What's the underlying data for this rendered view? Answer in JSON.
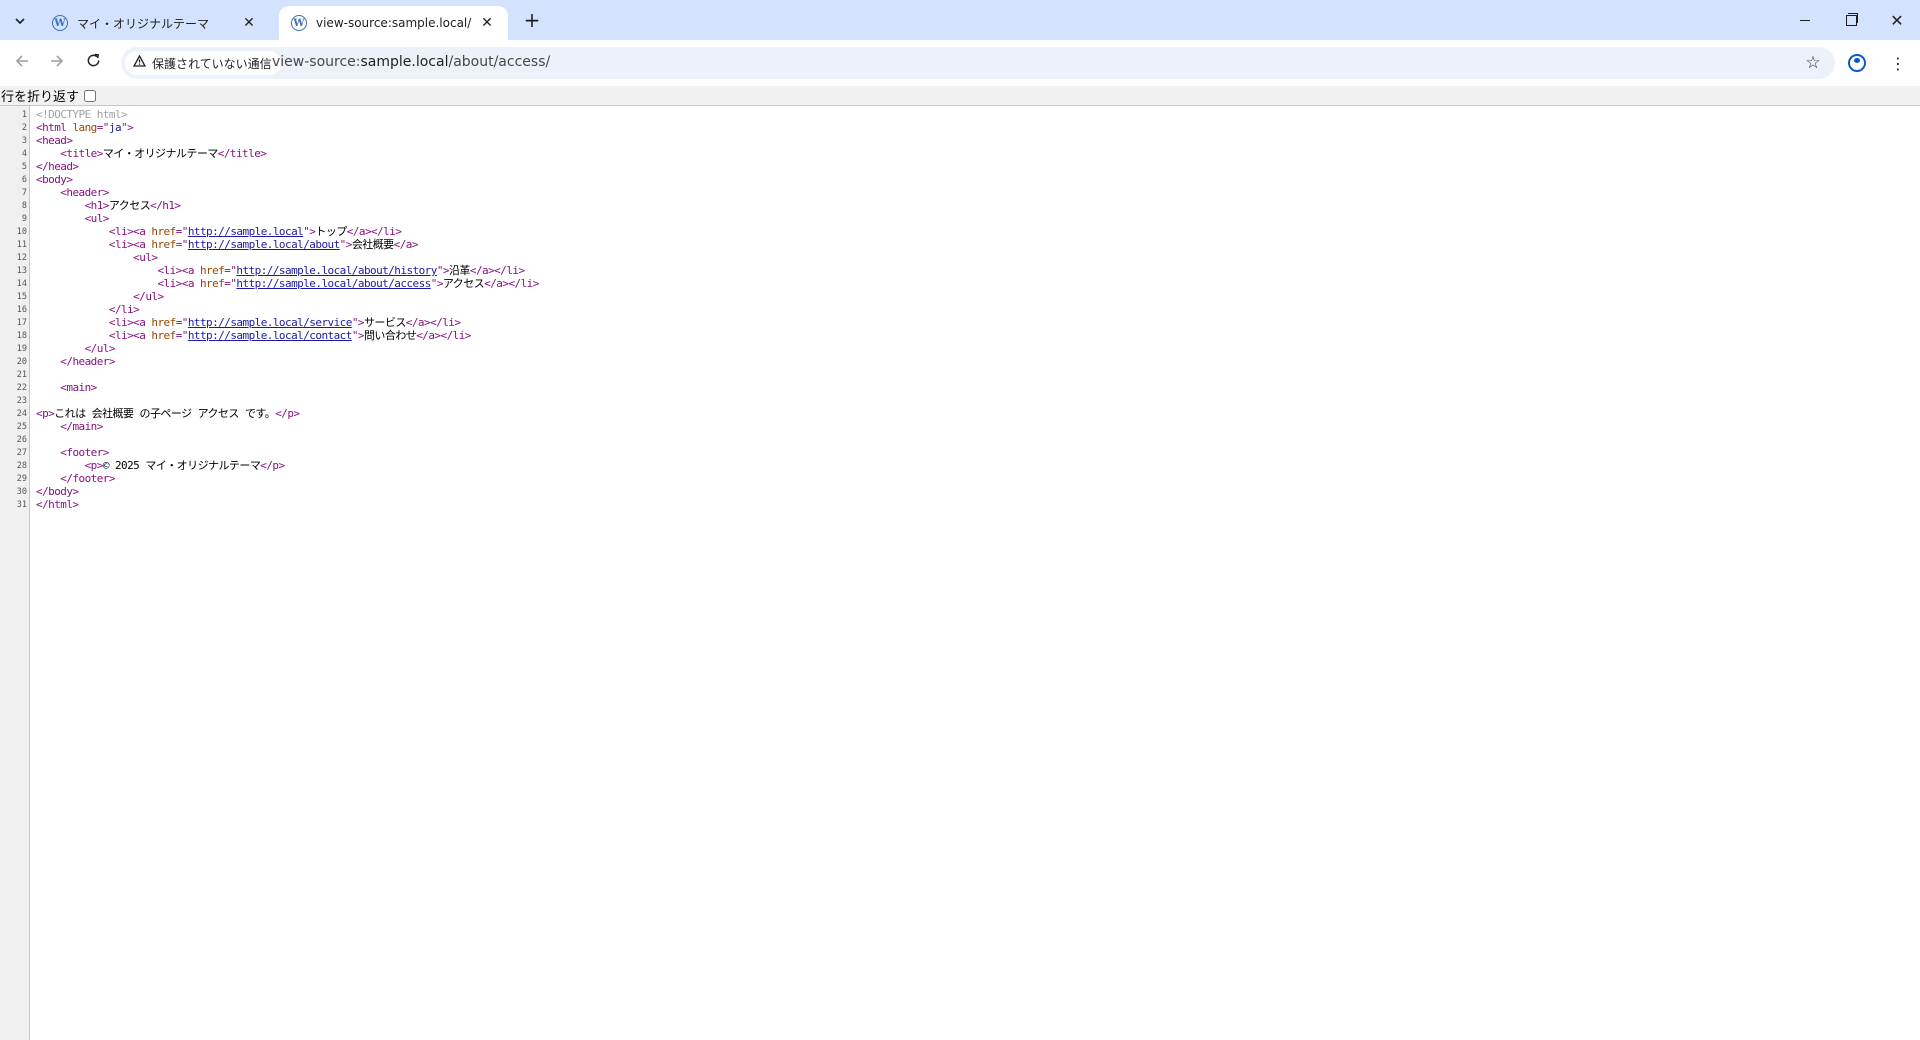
{
  "tabs": [
    {
      "title": "マイ・オリジナルテーマ",
      "active": false
    },
    {
      "title": "view-source:sample.local/about",
      "active": true
    }
  ],
  "toolbar": {
    "security_label": "保護されていない通信",
    "url_scheme": "view-source:",
    "url_host": "sample.local",
    "url_path": "/about/access/"
  },
  "page": {
    "wrap_label": "行を折り返す",
    "wrap_checked": false
  },
  "icons": {
    "tab_search": "chevron-down-icon",
    "favicon": "wordpress-icon",
    "close": "close-icon",
    "new_tab": "plus-icon",
    "back": "arrow-left-icon",
    "forward": "arrow-right-icon",
    "reload": "reload-icon",
    "warning": "warning-triangle-icon",
    "bookmark": "star-icon",
    "profile": "profile-icon",
    "menu": "kebab-menu-icon"
  },
  "source_lines": [
    {
      "n": "1",
      "indent": "",
      "parts": [
        [
          "doctype",
          "<!DOCTYPE html>"
        ]
      ]
    },
    {
      "n": "2",
      "indent": "",
      "parts": [
        [
          "tag",
          "<html "
        ],
        [
          "attr",
          "lang"
        ],
        [
          "tag",
          "=\""
        ],
        [
          "val",
          "ja"
        ],
        [
          "tag",
          "\">"
        ]
      ]
    },
    {
      "n": "3",
      "indent": "",
      "parts": [
        [
          "tag",
          "<head>"
        ]
      ]
    },
    {
      "n": "4",
      "indent": "    ",
      "parts": [
        [
          "tag",
          "<title>"
        ],
        [
          "text",
          "マイ・オリジナルテーマ"
        ],
        [
          "tag",
          "</title>"
        ]
      ]
    },
    {
      "n": "5",
      "indent": "",
      "parts": [
        [
          "tag",
          "</head>"
        ]
      ]
    },
    {
      "n": "6",
      "indent": "",
      "parts": [
        [
          "tag",
          "<body>"
        ]
      ]
    },
    {
      "n": "7",
      "indent": "    ",
      "parts": [
        [
          "tag",
          "<header>"
        ]
      ]
    },
    {
      "n": "8",
      "indent": "        ",
      "parts": [
        [
          "tag",
          "<h1>"
        ],
        [
          "text",
          "アクセス"
        ],
        [
          "tag",
          "</h1>"
        ]
      ]
    },
    {
      "n": "9",
      "indent": "        ",
      "parts": [
        [
          "tag",
          "<ul>"
        ]
      ]
    },
    {
      "n": "10",
      "indent": "            ",
      "parts": [
        [
          "tag",
          "<li><a "
        ],
        [
          "attr",
          "href"
        ],
        [
          "tag",
          "=\""
        ],
        [
          "link",
          "http://sample.local"
        ],
        [
          "tag",
          "\">"
        ],
        [
          "text",
          "トップ"
        ],
        [
          "tag",
          "</a></li>"
        ]
      ]
    },
    {
      "n": "11",
      "indent": "            ",
      "parts": [
        [
          "tag",
          "<li><a "
        ],
        [
          "attr",
          "href"
        ],
        [
          "tag",
          "=\""
        ],
        [
          "link",
          "http://sample.local/about"
        ],
        [
          "tag",
          "\">"
        ],
        [
          "text",
          "会社概要"
        ],
        [
          "tag",
          "</a>"
        ]
      ]
    },
    {
      "n": "12",
      "indent": "                ",
      "parts": [
        [
          "tag",
          "<ul>"
        ]
      ]
    },
    {
      "n": "13",
      "indent": "                    ",
      "parts": [
        [
          "tag",
          "<li><a "
        ],
        [
          "attr",
          "href"
        ],
        [
          "tag",
          "=\""
        ],
        [
          "link",
          "http://sample.local/about/history"
        ],
        [
          "tag",
          "\">"
        ],
        [
          "text",
          "沿革"
        ],
        [
          "tag",
          "</a></li>"
        ]
      ]
    },
    {
      "n": "14",
      "indent": "                    ",
      "parts": [
        [
          "tag",
          "<li><a "
        ],
        [
          "attr",
          "href"
        ],
        [
          "tag",
          "=\""
        ],
        [
          "link",
          "http://sample.local/about/access"
        ],
        [
          "tag",
          "\">"
        ],
        [
          "text",
          "アクセス"
        ],
        [
          "tag",
          "</a></li>"
        ]
      ]
    },
    {
      "n": "15",
      "indent": "                ",
      "parts": [
        [
          "tag",
          "</ul>"
        ]
      ]
    },
    {
      "n": "16",
      "indent": "            ",
      "parts": [
        [
          "tag",
          "</li>"
        ]
      ]
    },
    {
      "n": "17",
      "indent": "            ",
      "parts": [
        [
          "tag",
          "<li><a "
        ],
        [
          "attr",
          "href"
        ],
        [
          "tag",
          "=\""
        ],
        [
          "link",
          "http://sample.local/service"
        ],
        [
          "tag",
          "\">"
        ],
        [
          "text",
          "サービス"
        ],
        [
          "tag",
          "</a></li>"
        ]
      ]
    },
    {
      "n": "18",
      "indent": "            ",
      "parts": [
        [
          "tag",
          "<li><a "
        ],
        [
          "attr",
          "href"
        ],
        [
          "tag",
          "=\""
        ],
        [
          "link",
          "http://sample.local/contact"
        ],
        [
          "tag",
          "\">"
        ],
        [
          "text",
          "問い合わせ"
        ],
        [
          "tag",
          "</a></li>"
        ]
      ]
    },
    {
      "n": "19",
      "indent": "        ",
      "parts": [
        [
          "tag",
          "</ul>"
        ]
      ]
    },
    {
      "n": "20",
      "indent": "    ",
      "parts": [
        [
          "tag",
          "</header>"
        ]
      ]
    },
    {
      "n": "21",
      "indent": "",
      "parts": []
    },
    {
      "n": "22",
      "indent": "    ",
      "parts": [
        [
          "tag",
          "<main>"
        ]
      ]
    },
    {
      "n": "23",
      "indent": "",
      "parts": []
    },
    {
      "n": "24",
      "indent": "",
      "parts": [
        [
          "tag",
          "<p>"
        ],
        [
          "text",
          "これは 会社概要 の子ページ アクセス です。"
        ],
        [
          "tag",
          "</p>"
        ]
      ]
    },
    {
      "n": "25",
      "indent": "    ",
      "parts": [
        [
          "tag",
          "</main>"
        ]
      ]
    },
    {
      "n": "26",
      "indent": "",
      "parts": []
    },
    {
      "n": "27",
      "indent": "    ",
      "parts": [
        [
          "tag",
          "<footer>"
        ]
      ]
    },
    {
      "n": "28",
      "indent": "        ",
      "parts": [
        [
          "tag",
          "<p>"
        ],
        [
          "text",
          "© 2025 マイ・オリジナルテーマ"
        ],
        [
          "tag",
          "</p>"
        ]
      ]
    },
    {
      "n": "29",
      "indent": "    ",
      "parts": [
        [
          "tag",
          "</footer>"
        ]
      ]
    },
    {
      "n": "30",
      "indent": "",
      "parts": [
        [
          "tag",
          "</body>"
        ]
      ]
    },
    {
      "n": "31",
      "indent": "",
      "parts": [
        [
          "tag",
          "</html>"
        ]
      ]
    }
  ]
}
